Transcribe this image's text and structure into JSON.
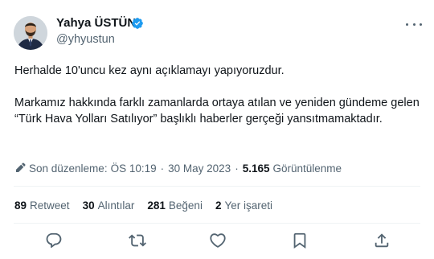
{
  "author": {
    "name": "Yahya ÜSTÜN",
    "handle": "@yhyustun",
    "verified": true
  },
  "tweet": {
    "paragraphs": [
      "Herhalde 10'uncu kez aynı açıklamayı yapıyoruzdur.",
      "Markamız hakkında farklı zamanlarda ortaya atılan ve yeniden gündeme gelen “Türk Hava Yolları Satılıyor” başlıklı haberler gerçeği yansıtmamaktadır."
    ]
  },
  "meta": {
    "edit_label": "Son düzenleme:",
    "time": "ÖS 10:19",
    "separator": "·",
    "date": "30 May 2023",
    "views_count": "5.165",
    "views_label": "Görüntülenme"
  },
  "stats": {
    "retweets": {
      "count": "89",
      "label": "Retweet"
    },
    "quotes": {
      "count": "30",
      "label": "Alıntılar"
    },
    "likes": {
      "count": "281",
      "label": "Beğeni"
    },
    "bookmarks": {
      "count": "2",
      "label": "Yer işareti"
    }
  },
  "icons": {
    "verified": "verified-badge-icon",
    "more": "more-options-icon",
    "edit": "pencil-icon",
    "reply": "reply-icon",
    "retweet": "retweet-icon",
    "like": "heart-icon",
    "bookmark": "bookmark-icon",
    "share": "share-icon"
  },
  "colors": {
    "text": "#0f1419",
    "secondary": "#536471",
    "verified": "#1d9bf0",
    "divider": "#eff3f4"
  }
}
